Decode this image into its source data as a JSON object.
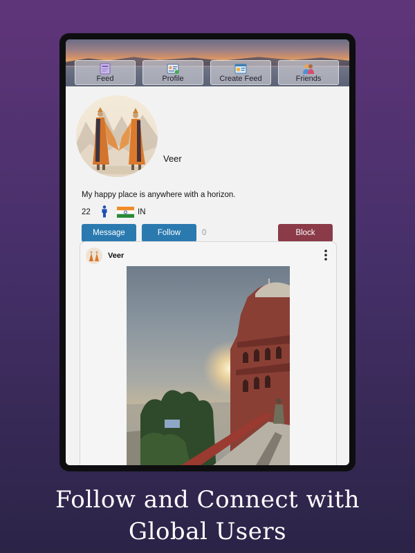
{
  "tabs": [
    {
      "label": "Feed",
      "icon": "feed-icon"
    },
    {
      "label": "Profile",
      "icon": "profile-icon"
    },
    {
      "label": "Create Feed",
      "icon": "create-feed-icon"
    },
    {
      "label": "Friends",
      "icon": "friends-icon"
    }
  ],
  "profile": {
    "username": "Veer",
    "bio": "My happy place is anywhere with a horizon.",
    "age": "22",
    "gender_icon": "male-icon",
    "flag_icon": "india-flag-icon",
    "country": "IN"
  },
  "actions": {
    "message_label": "Message",
    "follow_label": "Follow",
    "follow_count": "0",
    "block_label": "Block"
  },
  "post": {
    "username": "Veer",
    "menu_icon": "more-vertical-icon"
  },
  "caption": {
    "line1": "Follow and Connect with",
    "line2": "Global Users"
  },
  "colors": {
    "primary_button": "#2a7ab0",
    "block_button": "#8b3a48",
    "background_top": "#5f3579",
    "background_bottom": "#2b2447"
  }
}
